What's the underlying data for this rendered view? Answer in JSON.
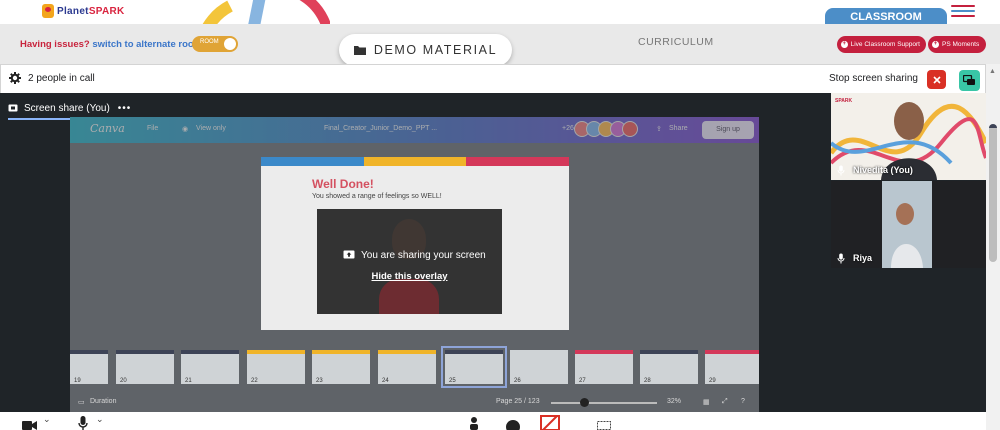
{
  "header": {
    "logo_part1": "Planet",
    "logo_part2": "SPARK",
    "classroom_tab": "CLASSROOM",
    "hamburger_colors": [
      "#c4203e",
      "#4c8ec8",
      "#c4203e"
    ]
  },
  "infobar": {
    "issues_text": "Having issues?",
    "switch_link": "switch to alternate room",
    "toggle_label": "ROOM",
    "demo_material": "DEMO MATERIAL",
    "curriculum": "CURRICULUM",
    "live_support": "Live Classroom Support",
    "ps_moments": "PS Moments"
  },
  "callbar": {
    "people": "2 people in call",
    "stop_sharing": "Stop screen sharing"
  },
  "stage": {
    "share_tab": "Screen share (You)",
    "share_more": "•••"
  },
  "canva": {
    "brand": "Canva",
    "file": "File",
    "view_only": "View only",
    "doc_title": "Final_Creator_Junior_Demo_PPT ...",
    "collab_count": "+26",
    "share": "Share",
    "sign_up": "Sign up",
    "duration": "Duration",
    "page": "Page 25 / 123",
    "zoom": "32%"
  },
  "slide": {
    "title": "Well Done!",
    "subtitle": "You showed a range of feelings so WELL!",
    "band_colors": [
      "#3b89c9",
      "#f0b429",
      "#d4385a"
    ]
  },
  "overlay": {
    "sharing_text": "You are sharing your screen",
    "hide_link": "Hide this overlay"
  },
  "thumbnails": [
    {
      "n": "19"
    },
    {
      "n": "20"
    },
    {
      "n": "21"
    },
    {
      "n": "22"
    },
    {
      "n": "23"
    },
    {
      "n": "24"
    },
    {
      "n": "25"
    },
    {
      "n": "26"
    },
    {
      "n": "27"
    },
    {
      "n": "28"
    },
    {
      "n": "29"
    }
  ],
  "participants": [
    {
      "name": "Nivedita (You)"
    },
    {
      "name": "Riya"
    }
  ]
}
